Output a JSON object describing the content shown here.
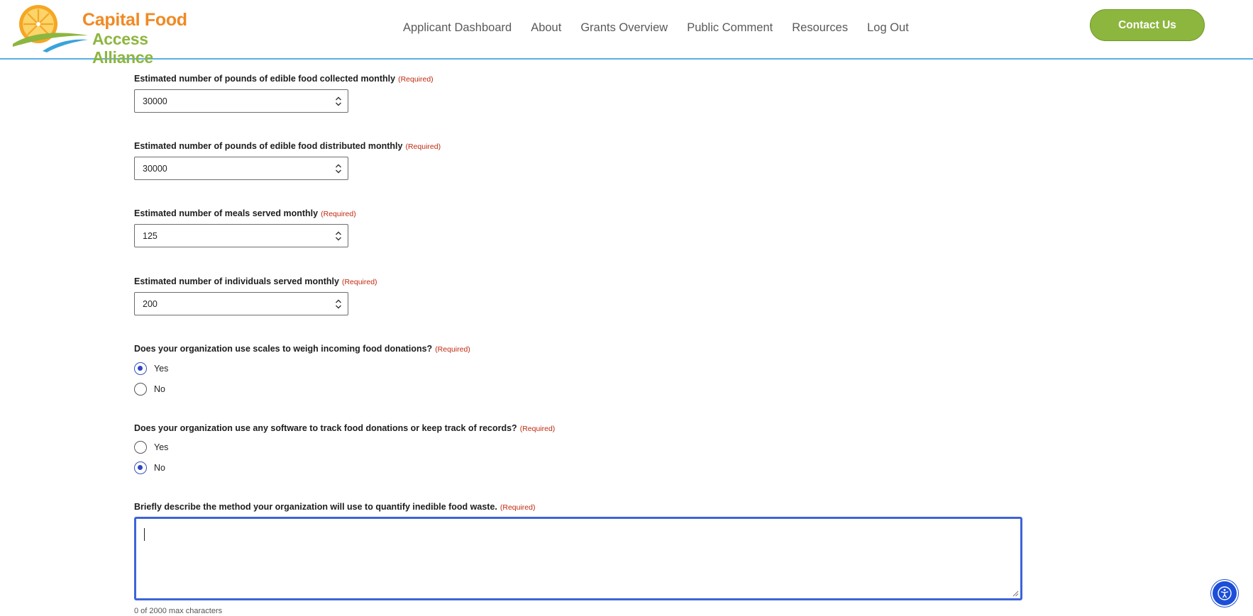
{
  "header": {
    "logo": {
      "line1": "Capital Food",
      "line2": "Access Alliance"
    },
    "nav": [
      {
        "label": "Applicant Dashboard"
      },
      {
        "label": "About"
      },
      {
        "label": "Grants Overview"
      },
      {
        "label": "Public Comment"
      },
      {
        "label": "Resources"
      },
      {
        "label": "Log Out"
      }
    ],
    "contact_label": "Contact Us"
  },
  "form": {
    "required_tag": "(Required)",
    "fields": [
      {
        "label": "Estimated number of pounds of edible food collected monthly",
        "value": "30000"
      },
      {
        "label": "Estimated number of pounds of edible food distributed monthly",
        "value": "30000"
      },
      {
        "label": "Estimated number of meals served monthly",
        "value": "125"
      },
      {
        "label": "Estimated number of individuals served monthly",
        "value": "200"
      }
    ],
    "questions": [
      {
        "label": "Does your organization use scales to weigh incoming food donations?",
        "options": [
          "Yes",
          "No"
        ],
        "selected": "Yes"
      },
      {
        "label": "Does your organization use any software to track food donations or keep track of records?",
        "options": [
          "Yes",
          "No"
        ],
        "selected": "No"
      }
    ],
    "description": {
      "label": "Briefly describe the method your organization will use to quantify inedible food waste.",
      "value": "",
      "counter": "0 of 2000 max characters"
    }
  },
  "colors": {
    "brand_orange": "#ef8a24",
    "brand_green": "#8db63f",
    "focus_blue": "#3e64d8",
    "required_red": "#c0290f"
  },
  "icons": {
    "spinner": "up-down-chevron-icon",
    "accessibility": "accessibility-person-icon"
  }
}
